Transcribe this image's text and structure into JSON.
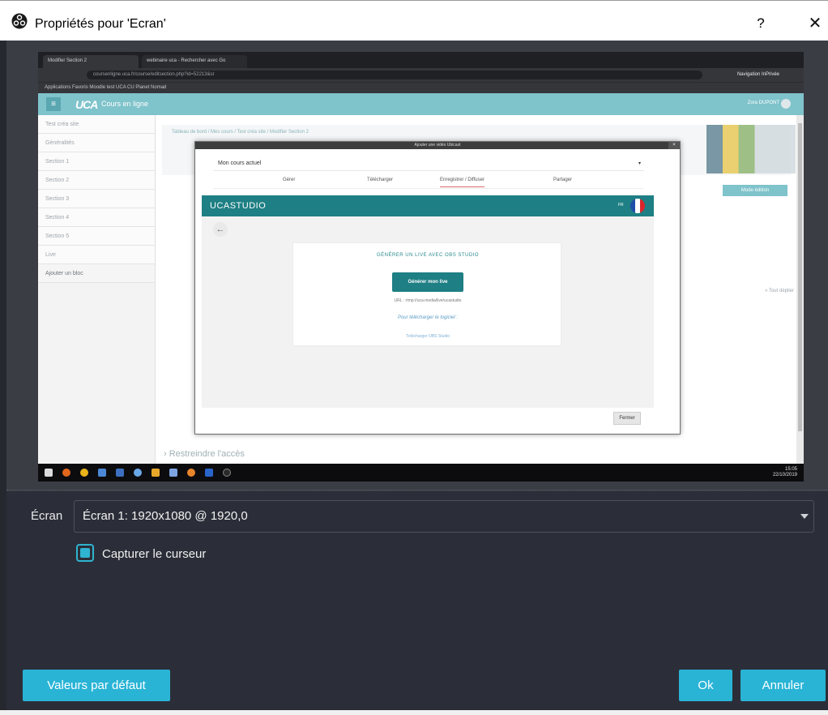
{
  "window": {
    "title": "Propriétés pour 'Ecran'",
    "help": "?",
    "close": "✕"
  },
  "preview": {
    "browser": {
      "tabs": [
        "Modifier Section 2",
        "webinaire uca - Rechercher avec Go"
      ],
      "url": "coursenligne.uca.fr/course/editsection.php?id=52213&sr",
      "profile": "Navigation InPrivée",
      "bookmarks": "Applications  Favoris  Moodle test UCA CU  Planet Nomad"
    },
    "lms": {
      "brand": "UCA",
      "site": "Cours en ligne",
      "user": "Zora DUPONT",
      "nav": [
        "Test créa site",
        "Généralités",
        "Section 1",
        "Section 2",
        "Section 3",
        "Section 4",
        "Section 5",
        "Live",
        "Ajouter un bloc"
      ],
      "breadcrumb": "Tableau de bord / Mes cours / Test créa site / Modifier Section 2",
      "edit_mode": "Mode édition",
      "expand_all": "» Tout déplier",
      "restrict": "› Restreindre l'accès"
    },
    "modal": {
      "title": "Ajouter une vidéo Ubicast",
      "close": "×",
      "course_select": "Mon cours actuel",
      "tabs": [
        "Gérer",
        "Télécharger",
        "Enregistrer / Diffuser",
        "Partager"
      ],
      "studio_brand": "UCASTUDIO",
      "lang": "FR",
      "back": "←",
      "heading": "GÉNÉRER UN LIVE AVEC OBS STUDIO",
      "generate_btn": "Générer mon live",
      "stream_url": "URL : rtmp://uca.media/live/ucastudio",
      "download_label": "Pour télécharger le logiciel :",
      "download_link": "Télécharger OBS Studio",
      "close_btn": "Fermer"
    },
    "taskbar": {
      "time": "15:05",
      "date": "22/10/2019"
    }
  },
  "form": {
    "screen_label": "Écran",
    "screen_value": "Écran 1: 1920x1080 @ 1920,0",
    "cursor_label": "Capturer le curseur",
    "cursor_checked": true
  },
  "buttons": {
    "defaults": "Valeurs par défaut",
    "ok": "Ok",
    "cancel": "Annuler"
  },
  "colors": {
    "accent": "#29b4d6",
    "dialog_bg": "#2b2e38",
    "uca_teal": "#7fc3cb",
    "studio_teal": "#1e7f84"
  }
}
